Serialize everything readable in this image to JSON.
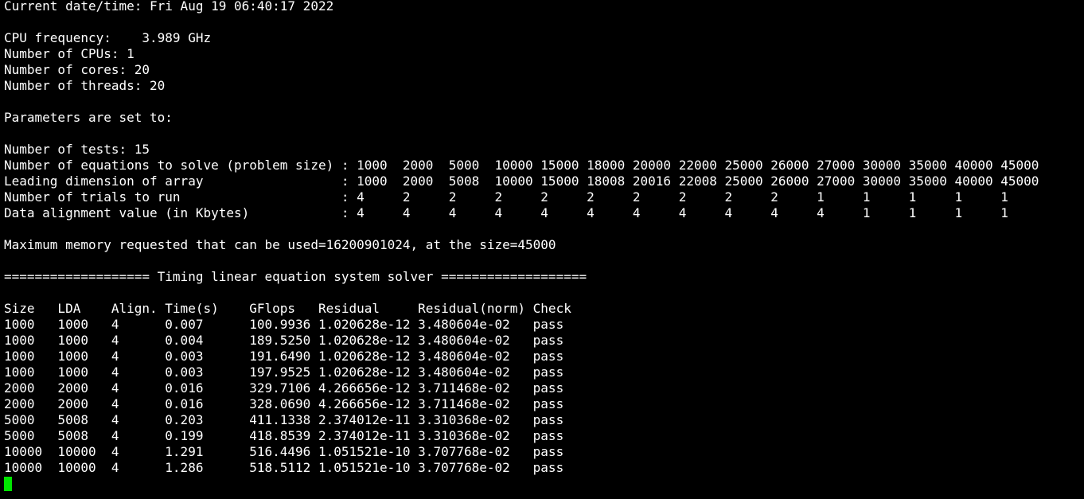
{
  "terminal": {
    "lines": [
      "Current date/time: Fri Aug 19 06:40:17 2022",
      "",
      "CPU frequency:    3.989 GHz",
      "Number of CPUs: 1",
      "Number of cores: 20",
      "Number of threads: 20",
      "",
      "Parameters are set to:",
      "",
      "Number of tests: 15",
      "Number of equations to solve (problem size) : 1000  2000  5000  10000 15000 18000 20000 22000 25000 26000 27000 30000 35000 40000 45000",
      "Leading dimension of array                  : 1000  2000  5008  10000 15000 18008 20016 22008 25000 26000 27000 30000 35000 40000 45000",
      "Number of trials to run                     : 4     2     2     2     2     2     2     2     2     2     1     1     1     1     1",
      "Data alignment value (in Kbytes)            : 4     4     4     4     4     4     4     4     4     4     4     1     1     1     1",
      "",
      "Maximum memory requested that can be used=16200901024, at the size=45000",
      "",
      "=================== Timing linear equation system solver ===================",
      "",
      "Size   LDA    Align. Time(s)    GFlops   Residual     Residual(norm) Check",
      "1000   1000   4      0.007      100.9936 1.020628e-12 3.480604e-02   pass",
      "1000   1000   4      0.004      189.5250 1.020628e-12 3.480604e-02   pass",
      "1000   1000   4      0.003      191.6490 1.020628e-12 3.480604e-02   pass",
      "1000   1000   4      0.003      197.9525 1.020628e-12 3.480604e-02   pass",
      "2000   2000   4      0.016      329.7106 4.266656e-12 3.711468e-02   pass",
      "2000   2000   4      0.016      328.0690 4.266656e-12 3.711468e-02   pass",
      "5000   5008   4      0.203      411.1338 2.374012e-11 3.310368e-02   pass",
      "5000   5008   4      0.199      418.8539 2.374012e-11 3.310368e-02   pass",
      "10000  10000  4      1.291      516.4496 1.051521e-10 3.707768e-02   pass",
      "10000  10000  4      1.286      518.5112 1.051521e-10 3.707768e-02   pass"
    ]
  },
  "colors": {
    "background": "#000000",
    "foreground": "#ffffff",
    "cursor": "#00e600"
  }
}
